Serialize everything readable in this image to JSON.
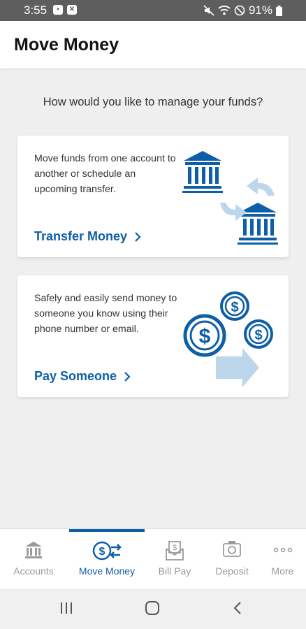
{
  "status_bar": {
    "time": "3:55",
    "battery": "91%"
  },
  "header": {
    "title": "Move Money"
  },
  "prompt": "How would you like to manage your funds?",
  "cards": [
    {
      "description": "Move funds from one account to another or schedule an upcoming transfer.",
      "action_label": "Transfer Money",
      "icon": "bank-transfer-illustration"
    },
    {
      "description": "Safely and easily send money to someone you know using their phone number or email.",
      "action_label": "Pay Someone",
      "icon": "dollar-coins-illustration"
    }
  ],
  "bottom_nav": {
    "items": [
      {
        "label": "Accounts",
        "icon": "bank-icon",
        "active": false
      },
      {
        "label": "Move Money",
        "icon": "dollar-transfer-icon",
        "active": true
      },
      {
        "label": "Bill Pay",
        "icon": "bill-envelope-icon",
        "active": false
      },
      {
        "label": "Deposit",
        "icon": "camera-icon",
        "active": false
      },
      {
        "label": "More",
        "icon": "more-dots-icon",
        "active": false
      }
    ]
  },
  "colors": {
    "brand": "#0f5ea8",
    "accent_light": "#bcd7ec",
    "inactive": "#9a9a9a",
    "background": "#efefef"
  },
  "system_nav": {
    "icons": [
      "recents-icon",
      "home-icon",
      "back-icon"
    ]
  }
}
